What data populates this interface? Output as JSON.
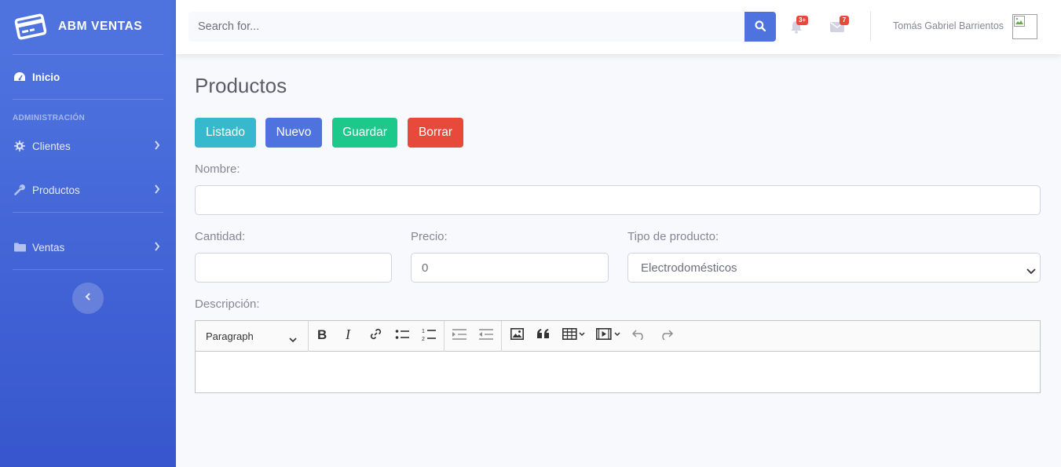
{
  "brand": {
    "name": "ABM VENTAS",
    "icon": "credit-card-icon"
  },
  "sidebar": {
    "home": {
      "label": "Inicio",
      "icon": "dashboard-icon"
    },
    "section_heading": "ADMINISTRACIÓN",
    "items": [
      {
        "label": "Clientes",
        "icon": "gear-icon"
      },
      {
        "label": "Productos",
        "icon": "wrench-icon"
      },
      {
        "label": "Ventas",
        "icon": "folder-icon"
      }
    ],
    "toggle_icon": "chevron-left-icon"
  },
  "topbar": {
    "search_placeholder": "Search for...",
    "alerts_badge": "3+",
    "messages_badge": "7",
    "user_name": "Tomás Gabriel Barrientos"
  },
  "page": {
    "title": "Productos",
    "buttons": {
      "list": "Listado",
      "new": "Nuevo",
      "save": "Guardar",
      "delete": "Borrar"
    },
    "form": {
      "name_label": "Nombre:",
      "name_value": "",
      "quantity_label": "Cantidad:",
      "quantity_value": "",
      "price_label": "Precio:",
      "price_value": "0",
      "type_label": "Tipo de producto:",
      "type_value": "Electrodomésticos",
      "description_label": "Descripción:"
    },
    "editor": {
      "heading_select": "Paragraph"
    }
  },
  "colors": {
    "primary": "#4e73df",
    "info": "#36b9cc",
    "success": "#1cc88a",
    "danger": "#e74a3b"
  }
}
